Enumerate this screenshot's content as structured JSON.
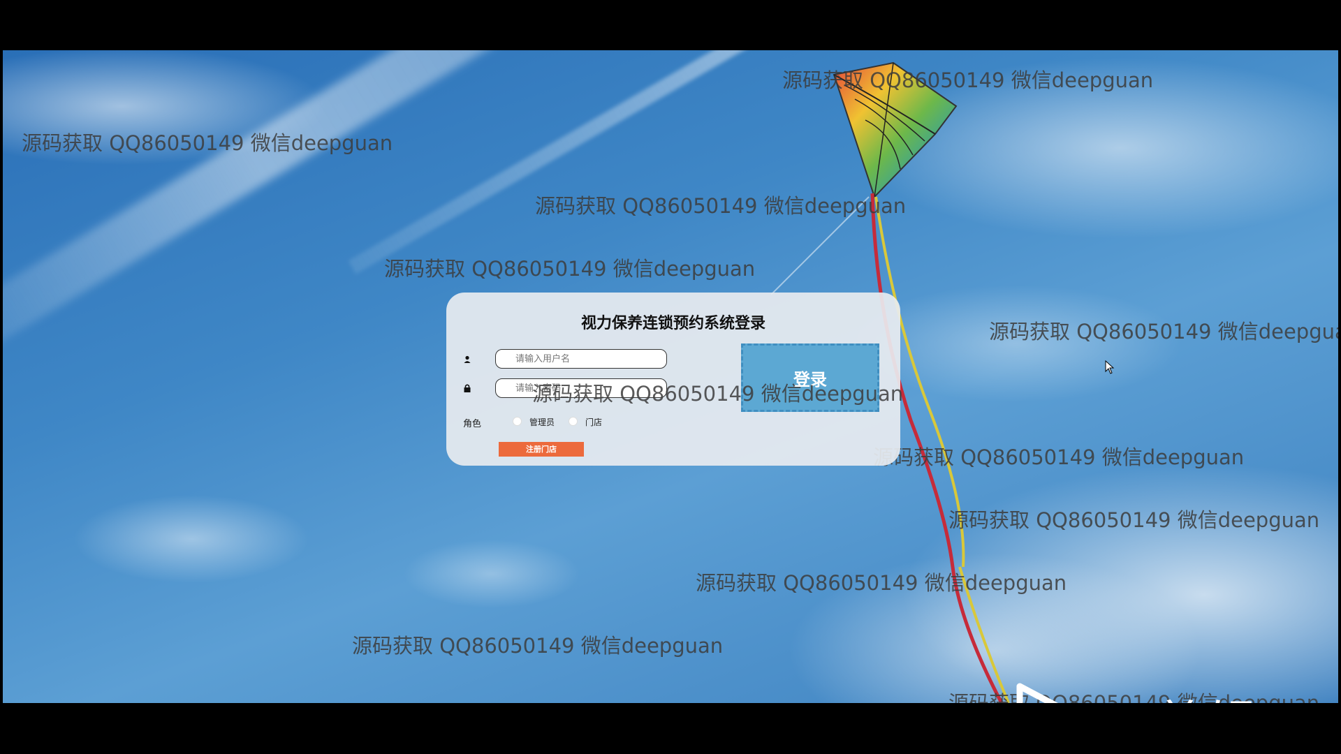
{
  "login": {
    "title": "视力保养连锁预约系统登录",
    "username_placeholder": "请输入用户名",
    "password_placeholder": "请输入密码",
    "role_label": "角色",
    "roles": [
      "管理员",
      "门店"
    ],
    "login_button": "登录",
    "register_button": "注册门店"
  },
  "watermark": {
    "text": "源码获取 QQ86050149 微信deepguan"
  },
  "overlay": {
    "brand_text": "eV剪辑"
  },
  "colors": {
    "sky": "#3f87c6",
    "card_bg": "#e8ecf0",
    "login_button": "#5ca8d3",
    "register_button": "#ec6a3c"
  },
  "icons": [
    "user-icon",
    "lock-icon",
    "mouse-cursor-icon",
    "ev-play-icon"
  ]
}
